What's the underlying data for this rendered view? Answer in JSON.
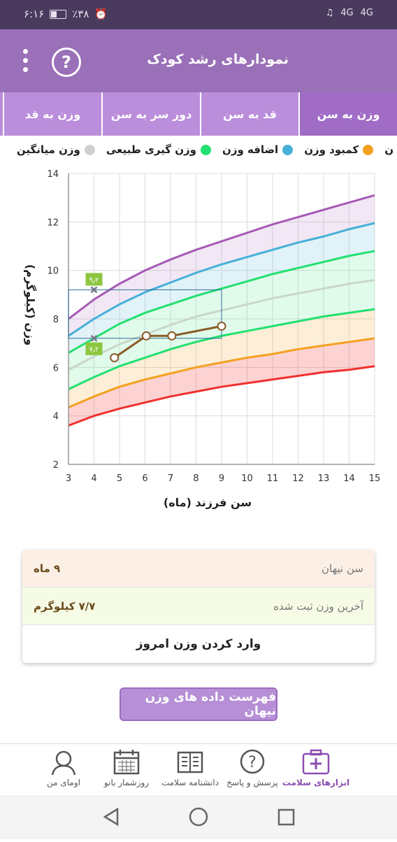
{
  "status": {
    "time": "۶:۱۶",
    "battery": "٪۳۸",
    "net1": "4G",
    "net2": "4G"
  },
  "header": {
    "title": "نمودارهای رشد کودک",
    "help_glyph": "?"
  },
  "tabs": [
    {
      "label": "وزن به سن",
      "active": true
    },
    {
      "label": "قد به سن",
      "active": false
    },
    {
      "label": "دور سر به سن",
      "active": false
    },
    {
      "label": "وزن به قد",
      "active": false
    }
  ],
  "legend": [
    {
      "label": "ن",
      "color": "#a65ab6"
    },
    {
      "label": "کمبود وزن",
      "color": "#f4a020"
    },
    {
      "label": "اضافه وزن",
      "color": "#45b0d8"
    },
    {
      "label": "وزن گیری طبیعی",
      "color": "#22e070"
    },
    {
      "label": "وزن میانگین",
      "color": "#d0d0d0"
    }
  ],
  "chart_data": {
    "type": "line",
    "title": "",
    "xlabel": "سن فرزند (ماه)",
    "ylabel": "وزن (کیلوگرم)",
    "xlim": [
      3,
      15
    ],
    "ylim": [
      2,
      14
    ],
    "xticks": [
      3,
      4,
      5,
      6,
      7,
      8,
      9,
      10,
      11,
      12,
      13,
      14,
      15
    ],
    "yticks": [
      2,
      4,
      6,
      8,
      10,
      12,
      14
    ],
    "grid": true,
    "x_curve": [
      3,
      4,
      5,
      6,
      7,
      8,
      9,
      10,
      11,
      12,
      13,
      14,
      15
    ],
    "curves": [
      {
        "color": "#a65ab6",
        "values": [
          8.0,
          8.8,
          9.45,
          10.0,
          10.45,
          10.85,
          11.2,
          11.55,
          11.9,
          12.2,
          12.5,
          12.8,
          13.1
        ]
      },
      {
        "color": "#45b0d8",
        "values": [
          7.3,
          8.0,
          8.6,
          9.1,
          9.5,
          9.9,
          10.25,
          10.55,
          10.85,
          11.15,
          11.4,
          11.7,
          11.95
        ]
      },
      {
        "color": "#22e070",
        "values": [
          6.6,
          7.2,
          7.8,
          8.25,
          8.6,
          8.95,
          9.25,
          9.55,
          9.85,
          10.1,
          10.35,
          10.6,
          10.8
        ]
      },
      {
        "color": "#c8d8c8",
        "values": [
          5.9,
          6.45,
          6.95,
          7.35,
          7.75,
          8.1,
          8.35,
          8.6,
          8.85,
          9.05,
          9.25,
          9.45,
          9.6
        ]
      },
      {
        "color": "#22e070",
        "values": [
          5.1,
          5.6,
          6.05,
          6.4,
          6.75,
          7.05,
          7.3,
          7.5,
          7.7,
          7.9,
          8.1,
          8.25,
          8.4
        ]
      },
      {
        "color": "#f4a020",
        "values": [
          4.35,
          4.8,
          5.2,
          5.5,
          5.75,
          6.0,
          6.2,
          6.4,
          6.55,
          6.75,
          6.9,
          7.05,
          7.2
        ]
      },
      {
        "color": "#f03030",
        "values": [
          3.6,
          4.0,
          4.3,
          4.55,
          4.8,
          5.0,
          5.2,
          5.35,
          5.5,
          5.65,
          5.8,
          5.9,
          6.05
        ]
      }
    ],
    "bands": [
      {
        "color": "#a65ab6",
        "opacity": 0.14
      },
      {
        "color": "#45b0d8",
        "opacity": 0.16
      },
      {
        "color": "#22e070",
        "opacity": 0.14
      },
      {
        "color": "#22e070",
        "opacity": 0.14
      },
      {
        "color": "#f4a020",
        "opacity": 0.18
      },
      {
        "color": "#f03030",
        "opacity": 0.22
      }
    ],
    "series": [
      {
        "color": "#8a5a2a",
        "x": [
          4.8,
          6.05,
          7.05,
          9.0
        ],
        "values": [
          6.4,
          7.3,
          7.3,
          7.7
        ]
      }
    ],
    "markers": [
      {
        "x": 4,
        "y": 9.2,
        "label": "۹٫۲"
      },
      {
        "x": 4,
        "y": 7.2,
        "label": "۷٫۲"
      }
    ],
    "range_box": {
      "x0": 3,
      "x1": 9,
      "y0": 7.2,
      "y1": 9.2
    }
  },
  "info": {
    "age_label": "سن نیهان",
    "age_value": "۹ ماه",
    "weight_label": "آخرین وزن ثبت شده",
    "weight_value": "۷/۷ کیلوگرم",
    "enter_label": "وارد کردن وزن امروز"
  },
  "list_button": "فهرست داده های وزن نیهان",
  "bottom_nav": [
    {
      "label": "ابزارهای سلامت",
      "icon": "first-aid-kit-icon",
      "active": true
    },
    {
      "label": "پرسش و پاسخ",
      "icon": "question-bubble-icon",
      "active": false
    },
    {
      "label": "دانشنامه سلامت",
      "icon": "book-icon",
      "active": false
    },
    {
      "label": "روزشمار بانو",
      "icon": "calendar-icon",
      "active": false
    },
    {
      "label": "اومای من",
      "icon": "profile-icon",
      "active": false
    }
  ],
  "colors": {
    "header": "#9a70b8",
    "tabs": "#bb8edc",
    "tab_active": "#a06cc6",
    "status": "#4a3a5e"
  }
}
